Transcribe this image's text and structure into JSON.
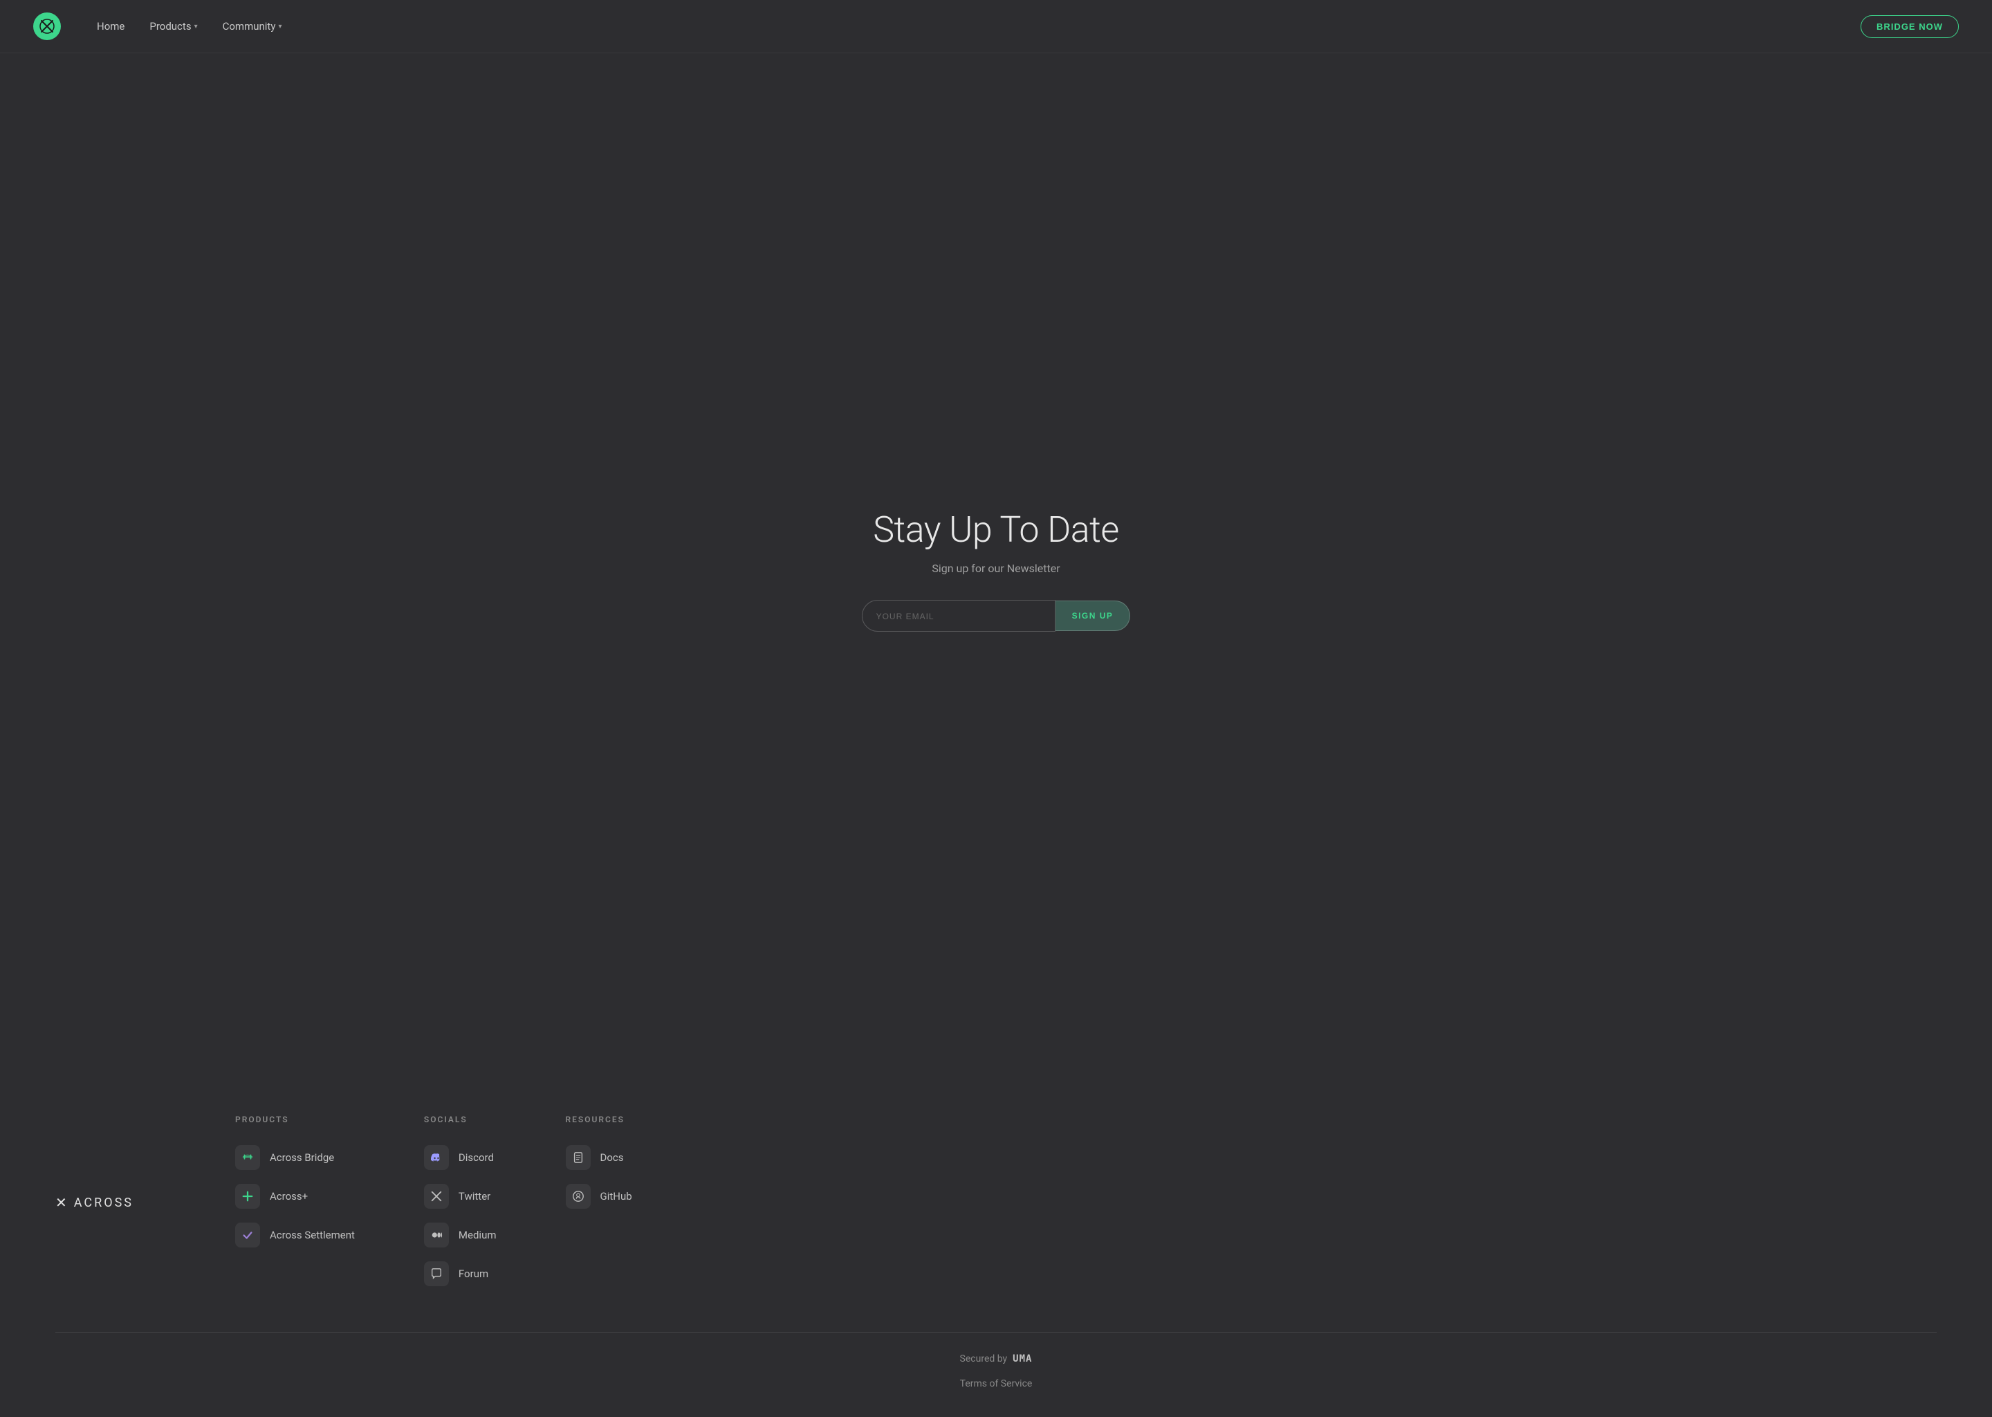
{
  "nav": {
    "home_label": "Home",
    "products_label": "Products",
    "community_label": "Community",
    "bridge_btn_label": "BRIDGE NOW"
  },
  "hero": {
    "title": "Stay Up To Date",
    "subtitle": "Sign up for our Newsletter",
    "email_placeholder": "YOUR EMAIL",
    "signup_btn": "SIGN UP"
  },
  "footer": {
    "brand_name": "ACROSS",
    "products_heading": "PRODUCTS",
    "socials_heading": "SOCIALS",
    "resources_heading": "RESOURCES",
    "products": [
      {
        "label": "Across Bridge",
        "icon": "bridge-icon"
      },
      {
        "label": "Across+",
        "icon": "plus-icon"
      },
      {
        "label": "Across Settlement",
        "icon": "check-icon"
      }
    ],
    "socials": [
      {
        "label": "Discord",
        "icon": "discord-icon"
      },
      {
        "label": "Twitter",
        "icon": "twitter-icon"
      },
      {
        "label": "Medium",
        "icon": "medium-icon"
      },
      {
        "label": "Forum",
        "icon": "forum-icon"
      }
    ],
    "resources": [
      {
        "label": "Docs",
        "icon": "docs-icon"
      },
      {
        "label": "GitHub",
        "icon": "github-icon"
      }
    ],
    "secured_by_label": "Secured by",
    "uma_label": "UMA",
    "terms_label": "Terms of Service"
  }
}
